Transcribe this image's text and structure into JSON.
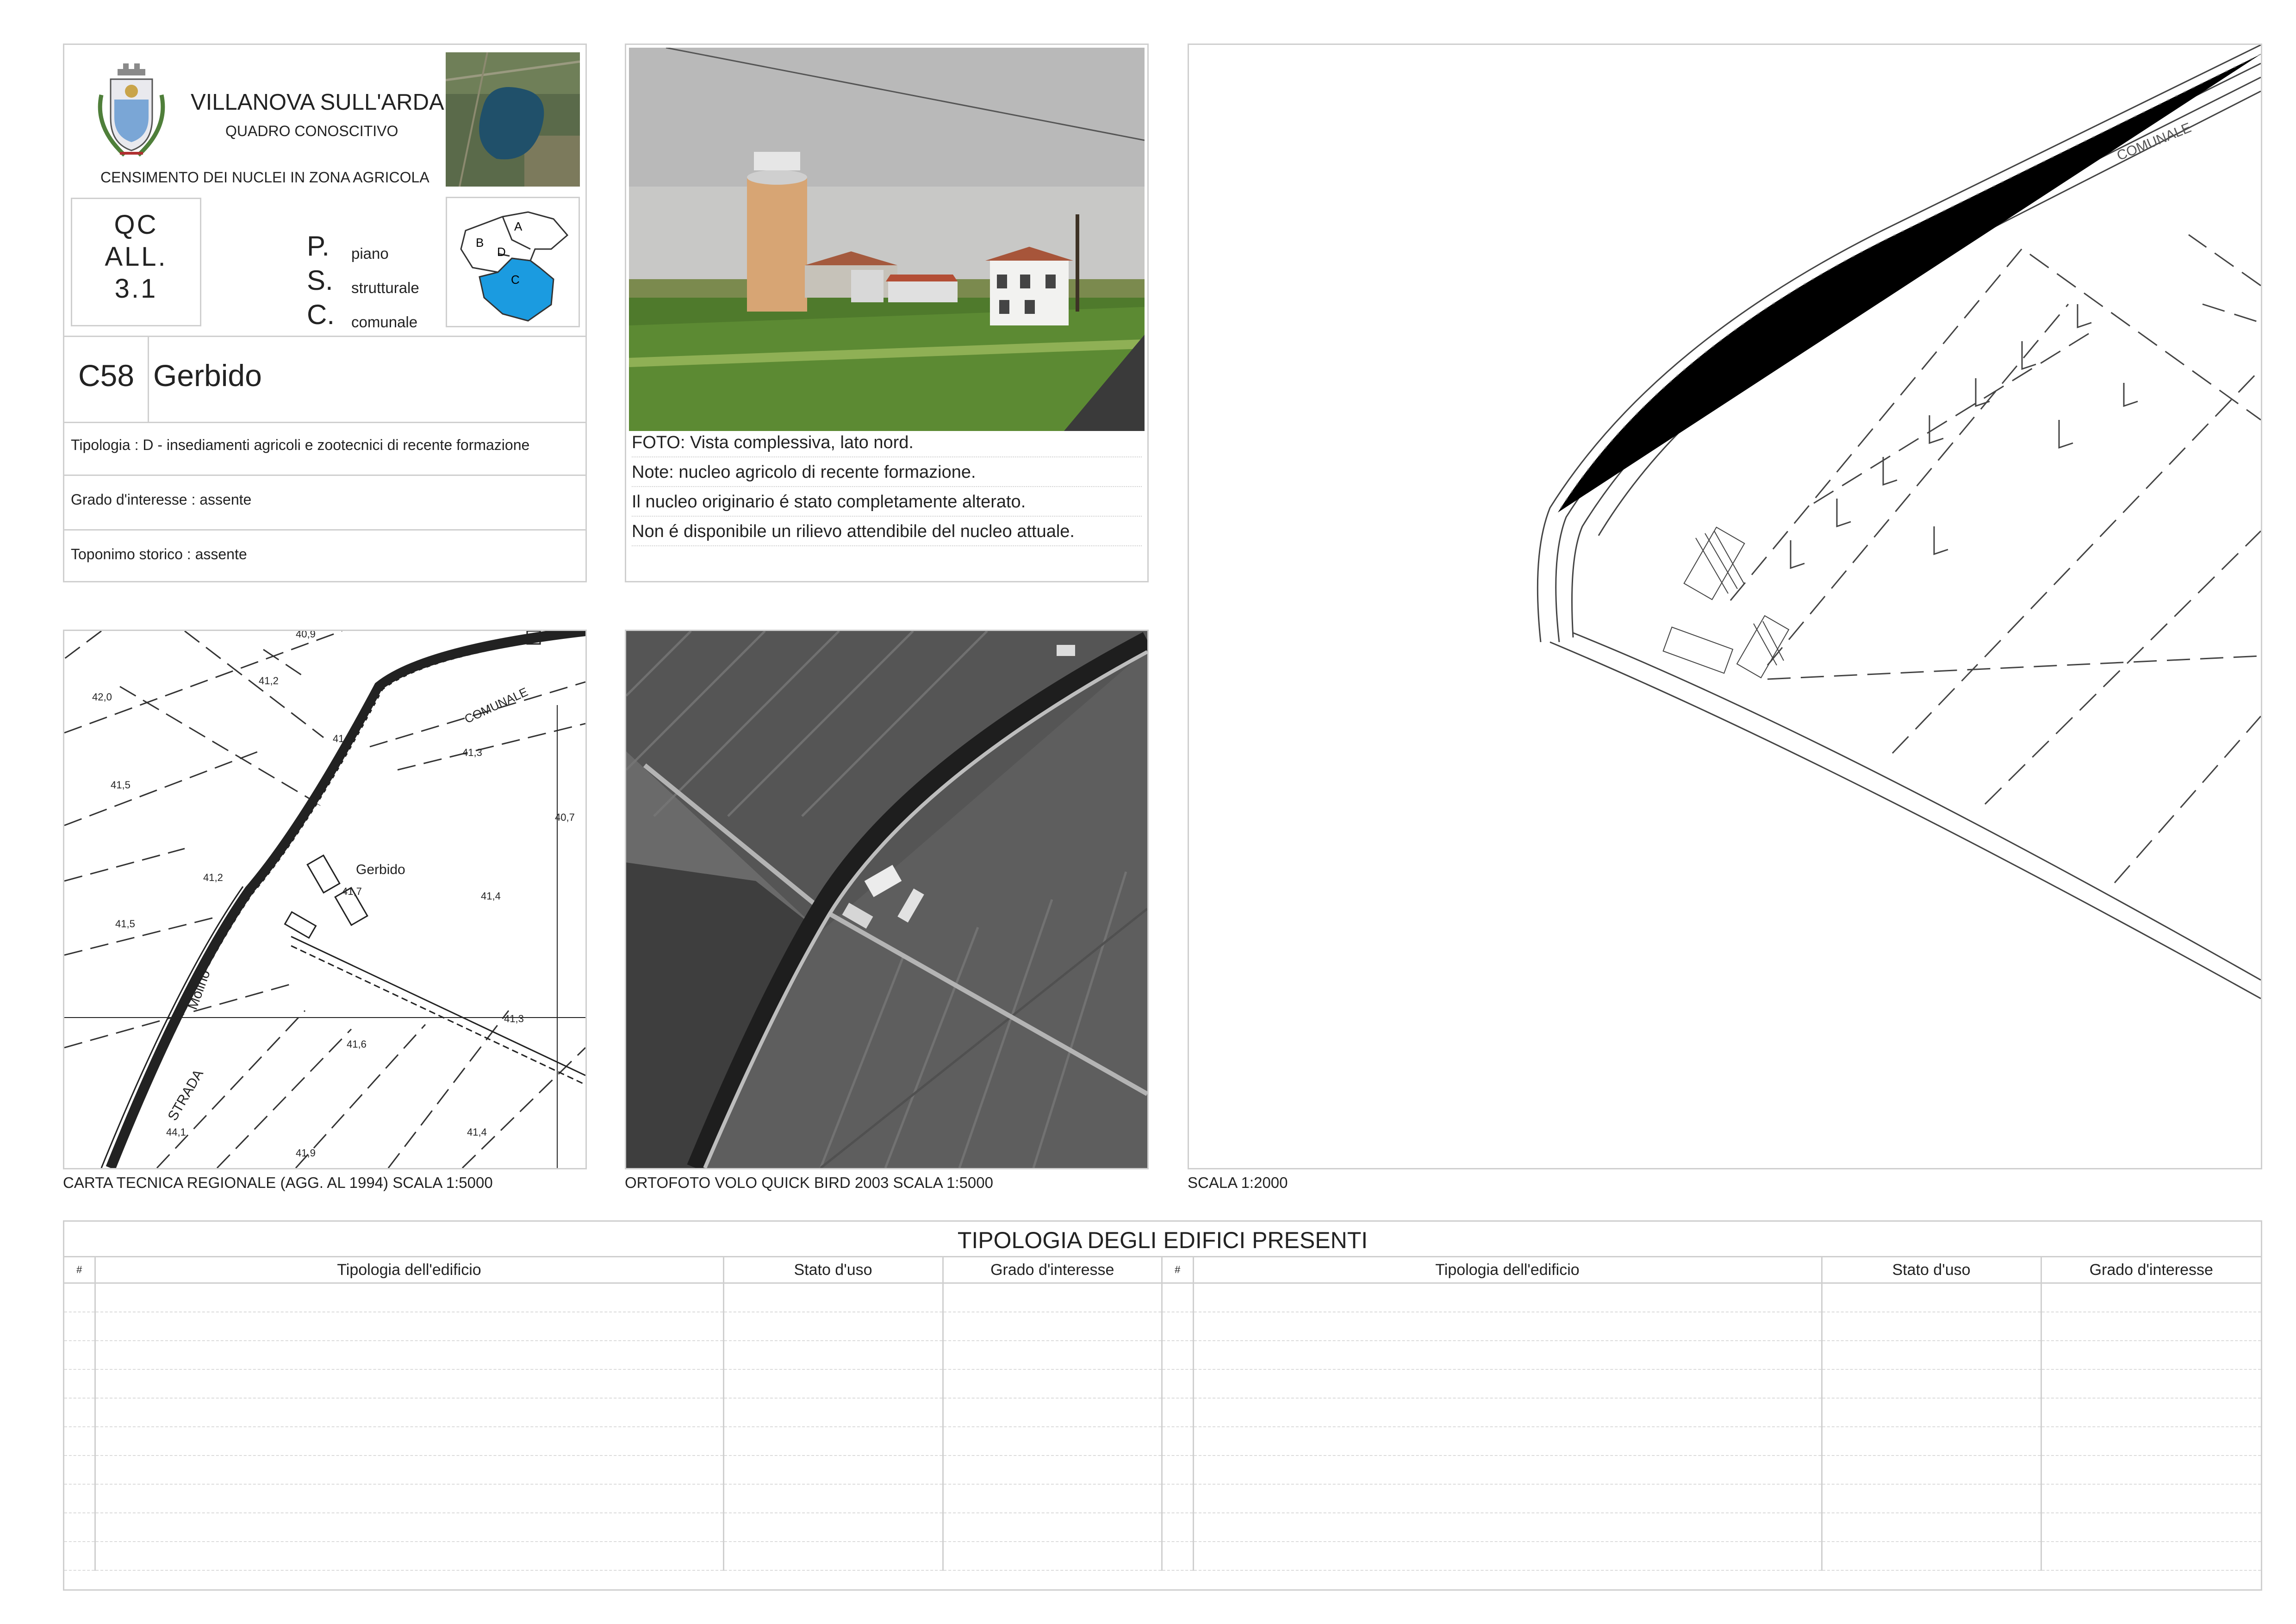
{
  "header": {
    "municipality": "VILLANOVA SULL'ARDA",
    "subtitle": "QUADRO CONOSCITIVO",
    "census": "CENSIMENTO DEI NUCLEI IN ZONA AGRICOLA",
    "doc_code": [
      "QC",
      "ALL.",
      "3.1"
    ],
    "psc": [
      {
        "letter": "P.",
        "word": "piano"
      },
      {
        "letter": "S.",
        "word": "strutturale"
      },
      {
        "letter": "C.",
        "word": "comunale"
      }
    ],
    "zone_labels": [
      "A",
      "B",
      "C",
      "D"
    ],
    "zone_highlight_color": "#1b9be0"
  },
  "nucleus": {
    "code": "C58",
    "name": "Gerbido",
    "tipologia": "Tipologia : D  - insediamenti agricoli e zootecnici di recente formazione",
    "grado": "Grado d'interesse : assente",
    "toponimo": "Toponimo storico : assente"
  },
  "photo_notes": [
    "FOTO: Vista complessiva, lato nord.",
    "Note: nucleo agricolo di recente formazione.",
    "Il nucleo originario é stato completamente alterato.",
    "Non é disponibile un rilievo attendibile del nucleo attuale."
  ],
  "ctr_map": {
    "caption": "CARTA TECNICA REGIONALE (AGG. AL 1994) SCALA 1:5000",
    "labels": [
      "40,9",
      "42,0",
      "41,2",
      "41,2",
      "41,3",
      "40,7",
      "COMUNALE",
      "41,5",
      "41,2",
      "41,7",
      "Gerbido",
      "41,4",
      "41,5",
      "Molino",
      "41,3",
      "41,6",
      "STRADA",
      "44,1",
      "41,4",
      "41,9"
    ]
  },
  "ortophoto": {
    "caption": "ORTOFOTO VOLO QUICK BIRD 2003 SCALA 1:5000"
  },
  "plan": {
    "caption": "SCALA 1:2000",
    "road_label": "COMUNALE"
  },
  "buildings_table": {
    "title": "TIPOLOGIA DEGLI EDIFICI PRESENTI",
    "headers": [
      "#",
      "Tipologia dell'edificio",
      "Stato d'uso",
      "Grado d'interesse"
    ],
    "rows": 11
  },
  "icons": [
    "coat-of-arms-icon",
    "aerial-thumbnail-icon",
    "zone-map-icon"
  ]
}
